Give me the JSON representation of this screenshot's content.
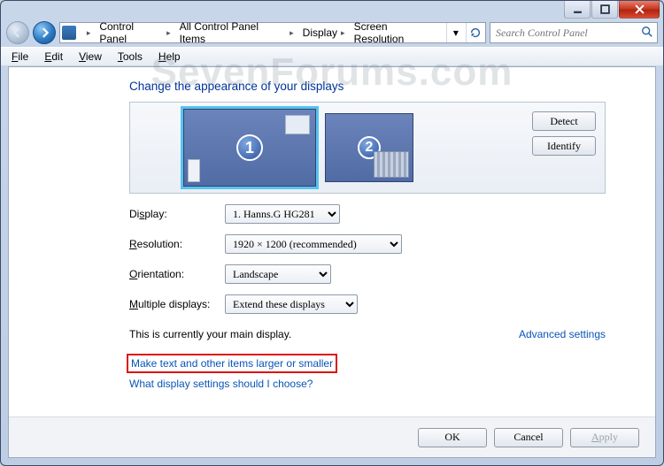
{
  "window": {
    "breadcrumbs": [
      "Control Panel",
      "All Control Panel Items",
      "Display",
      "Screen Resolution"
    ],
    "search_placeholder": "Search Control Panel"
  },
  "menu": {
    "file": "File",
    "edit": "Edit",
    "view": "View",
    "tools": "Tools",
    "help": "Help"
  },
  "page": {
    "heading": "Change the appearance of your displays",
    "detect": "Detect",
    "identify": "Identify",
    "monitors": [
      {
        "num": "1"
      },
      {
        "num": "2"
      }
    ],
    "labels": {
      "display": "Display:",
      "resolution": "Resolution:",
      "orientation": "Orientation:",
      "multiple": "Multiple displays:"
    },
    "values": {
      "display": "1. Hanns.G HG281",
      "resolution": "1920 × 1200 (recommended)",
      "orientation": "Landscape",
      "multiple": "Extend these displays"
    },
    "main_note": "This is currently your main display.",
    "advanced": "Advanced settings",
    "link_larger": "Make text and other items larger or smaller",
    "link_which": "What display settings should I choose?"
  },
  "footer": {
    "ok": "OK",
    "cancel": "Cancel",
    "apply": "Apply"
  },
  "watermark": "SevenForums.com"
}
